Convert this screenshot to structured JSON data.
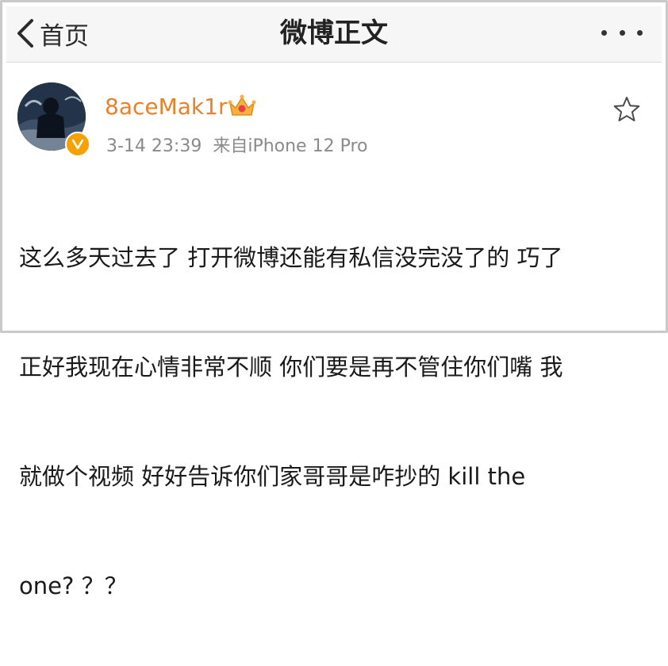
{
  "navbar": {
    "back_label": "首页",
    "title": "微博正文",
    "more_icon": "more-dots-icon",
    "back_icon": "chevron-left-icon"
  },
  "post": {
    "user": {
      "name": "8aceMak1r",
      "name_color": "#e8822a",
      "verified_badge": "V",
      "verified_color": "#f6a100"
    },
    "time": "3-14 23:39",
    "source": "来自iPhone 12 Pro",
    "favorite_icon": "star-outline-icon",
    "text_lines": [
      "这么多天过去了 打开微博还能有私信没完没了的 巧了",
      "正好我现在心情非常不顺 你们要是再不管住你们嘴 我",
      "就做个视频 好好告诉你们家哥哥是咋抄的 kill the",
      "one? ？？"
    ]
  }
}
